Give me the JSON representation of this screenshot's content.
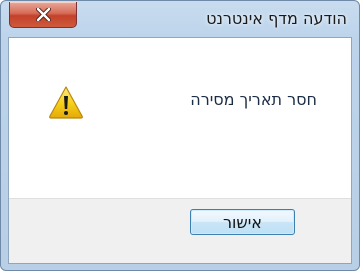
{
  "window": {
    "title": "הודעה מדף אינטרנט",
    "close_icon": "close-x-icon"
  },
  "dialog": {
    "icon": "warning-icon",
    "message": "חסר תאריך מסירה",
    "ok_label": "אישור"
  },
  "colors": {
    "title_bar": "#bcd3ea",
    "close_button": "#c3412a",
    "warning_yellow": "#f7d21c",
    "button_bg": "#e3f1fb"
  }
}
